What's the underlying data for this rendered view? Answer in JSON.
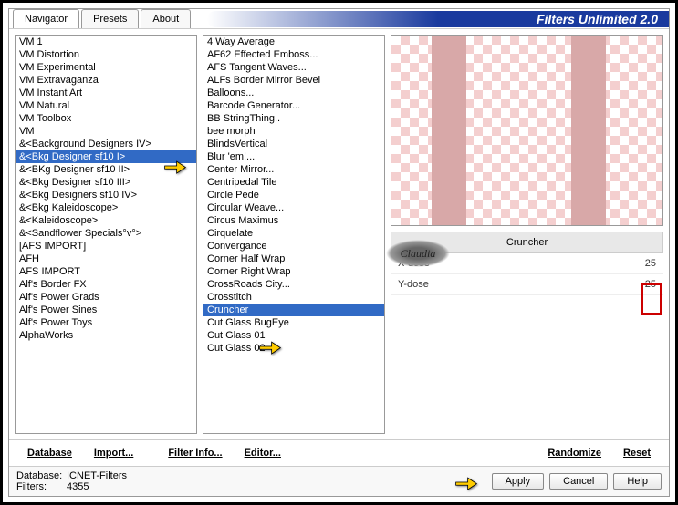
{
  "title": "Filters Unlimited 2.0",
  "tabs": [
    "Navigator",
    "Presets",
    "About"
  ],
  "activeTab": 0,
  "col1": {
    "items": [
      "VM 1",
      "VM Distortion",
      "VM Experimental",
      "VM Extravaganza",
      "VM Instant Art",
      "VM Natural",
      "VM Toolbox",
      "VM",
      "&<Background Designers IV>",
      "&<Bkg Designer sf10 I>",
      "&<BKg Designer sf10 II>",
      "&<Bkg Designer sf10 III>",
      "&<Bkg Designers sf10 IV>",
      "&<Bkg Kaleidoscope>",
      "&<Kaleidoscope>",
      "&<Sandflower Specials°v°>",
      "[AFS IMPORT]",
      "AFH",
      "AFS IMPORT",
      "Alf's Border FX",
      "Alf's Power Grads",
      "Alf's Power Sines",
      "Alf's Power Toys",
      "AlphaWorks"
    ],
    "selectedIndex": 9
  },
  "col2": {
    "items": [
      "4 Way Average",
      "AF62 Effected Emboss...",
      "AFS Tangent Waves...",
      "ALFs Border Mirror Bevel",
      "Balloons...",
      "Barcode Generator...",
      "BB StringThing..",
      "bee morph",
      "BlindsVertical",
      "Blur 'em!...",
      "Center Mirror...",
      "Centripedal Tile",
      "Circle Pede",
      "Circular Weave...",
      "Circus Maximus",
      "Cirquelate",
      "Convergance",
      "Corner Half Wrap",
      "Corner Right Wrap",
      "CrossRoads City...",
      "Crosstitch",
      "Cruncher",
      "Cut Glass  BugEye",
      "Cut Glass 01",
      "Cut Glass 02"
    ],
    "selectedIndex": 21
  },
  "selectedFilter": "Cruncher",
  "params": [
    {
      "label": "X-dose",
      "value": "25"
    },
    {
      "label": "Y-dose",
      "value": "25"
    }
  ],
  "buttons1": {
    "database": "Database",
    "import": "Import...",
    "filterinfo": "Filter Info...",
    "editor": "Editor...",
    "randomize": "Randomize",
    "reset": "Reset"
  },
  "status": {
    "dbLabel": "Database:",
    "dbValue": "ICNET-Filters",
    "filtersLabel": "Filters:",
    "filtersValue": "4355"
  },
  "actions": {
    "apply": "Apply",
    "cancel": "Cancel",
    "help": "Help"
  },
  "watermark": "Claudia"
}
